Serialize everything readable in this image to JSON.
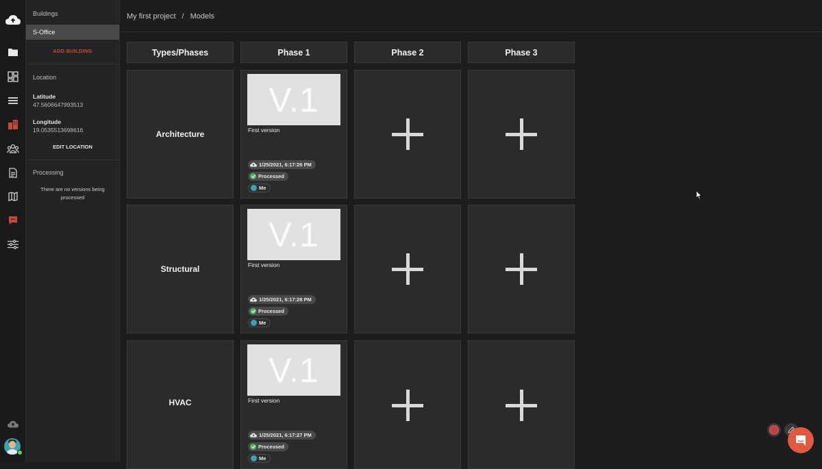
{
  "rail": {
    "icons": [
      "cloud-logo-icon",
      "folder-icon",
      "dashboard-icon",
      "layers-icon",
      "buildings-icon",
      "team-icon",
      "document-icon",
      "map-icon",
      "comment-icon",
      "settings-sliders-icon",
      "cloud-upload-icon"
    ],
    "accent": "#c64a3c"
  },
  "panel": {
    "buildings_title": "Buildings",
    "selected_building": "S-Office",
    "add_building": "ADD BUILDING",
    "location_title": "Location",
    "latitude_label": "Latitude",
    "latitude_value": "47.5606647993513",
    "longitude_label": "Longitude",
    "longitude_value": "19.0535513698616",
    "edit_location": "EDIT LOCATION",
    "processing_title": "Processing",
    "processing_empty": "There are no versions being processed"
  },
  "breadcrumb": {
    "project": "My first project",
    "separator": "/",
    "page": "Models"
  },
  "grid": {
    "headers": [
      "Types/Phases",
      "Phase 1",
      "Phase 2",
      "Phase 3"
    ],
    "rows": [
      {
        "type": "Architecture",
        "version": {
          "thumb": "V.1",
          "name": "First version",
          "date": "1/25/2021, 6:17:26 PM",
          "status": "Processed",
          "user": "Me"
        }
      },
      {
        "type": "Structural",
        "version": {
          "thumb": "V.1",
          "name": "First version",
          "date": "1/25/2021, 6:17:28 PM",
          "status": "Processed",
          "user": "Me"
        }
      },
      {
        "type": "HVAC",
        "version": {
          "thumb": "V.1",
          "name": "First version",
          "date": "1/25/2021, 6:17:27 PM",
          "status": "Processed",
          "user": "Me"
        }
      }
    ]
  },
  "colors": {
    "accent_red": "#c64a3c",
    "chat_button": "#e1593f",
    "processed_green": "#4cb85a"
  }
}
